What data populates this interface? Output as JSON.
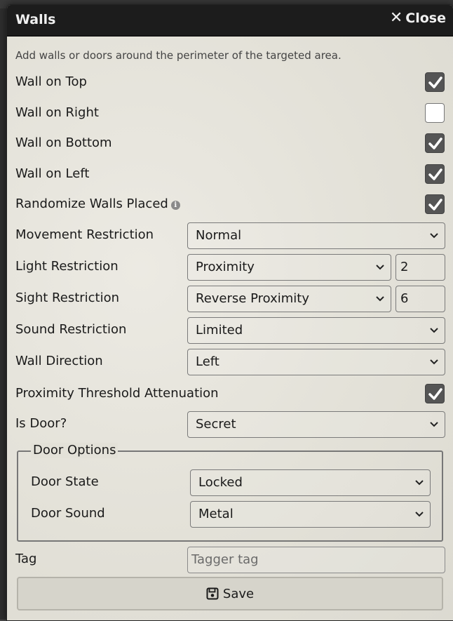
{
  "window": {
    "title": "Walls",
    "close_label": "Close",
    "hint": "Add walls or doors around the perimeter of the targeted area."
  },
  "checks": [
    {
      "label": "Wall on Top",
      "checked": true
    },
    {
      "label": "Wall on Right",
      "checked": false
    },
    {
      "label": "Wall on Bottom",
      "checked": true
    },
    {
      "label": "Wall on Left",
      "checked": true
    },
    {
      "label": "Randomize Walls Placed",
      "checked": true,
      "info": true
    }
  ],
  "selects": {
    "movement": {
      "label": "Movement Restriction",
      "value": "Normal"
    },
    "light": {
      "label": "Light Restriction",
      "value": "Proximity",
      "number": "2"
    },
    "sight": {
      "label": "Sight Restriction",
      "value": "Reverse Proximity",
      "number": "6"
    },
    "sound": {
      "label": "Sound Restriction",
      "value": "Limited"
    },
    "direction": {
      "label": "Wall Direction",
      "value": "Left"
    }
  },
  "attenuation": {
    "label": "Proximity Threshold Attenuation",
    "checked": true
  },
  "door": {
    "label": "Is Door?",
    "value": "Secret"
  },
  "door_options": {
    "legend": "Door Options",
    "state": {
      "label": "Door State",
      "value": "Locked"
    },
    "sound": {
      "label": "Door Sound",
      "value": "Metal"
    }
  },
  "tag": {
    "label": "Tag",
    "placeholder": "Tagger tag"
  },
  "save_label": "Save",
  "icons": [
    "close-icon",
    "checkmark-icon",
    "info-icon",
    "chevron-down-icon",
    "save-disk-icon"
  ]
}
